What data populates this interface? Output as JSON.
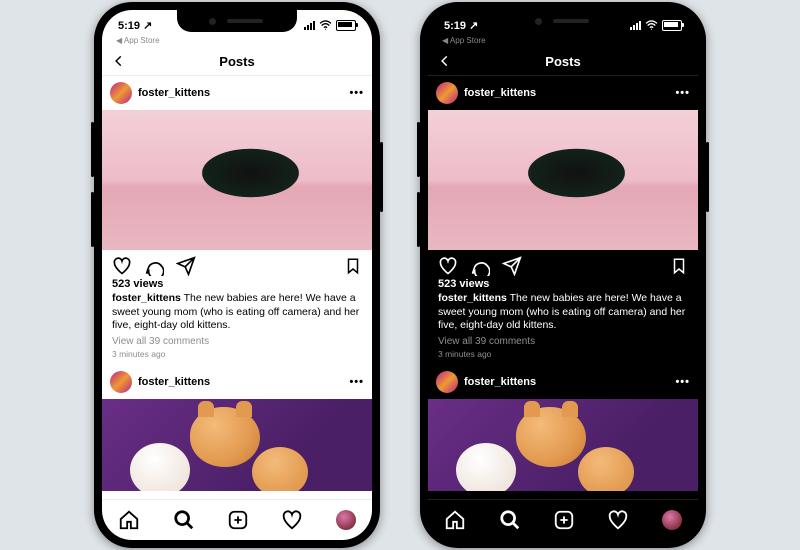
{
  "status": {
    "time": "5:19",
    "breadcrumb": "◀ App Store"
  },
  "header": {
    "title": "Posts"
  },
  "post": {
    "username": "foster_kittens",
    "views": "523 views",
    "caption_user": "foster_kittens",
    "caption_text": " The new babies are here! We have a sweet young mom (who is eating off camera) and her five, eight-day old kittens.",
    "view_comments": "View all 39 comments",
    "timestamp": "3 minutes ago"
  },
  "post2": {
    "username": "foster_kittens"
  },
  "icons": {
    "back": "chevron-left",
    "more": "•••",
    "like": "heart",
    "comment": "speech",
    "share": "paper-plane",
    "save": "bookmark",
    "home": "home",
    "search": "magnify",
    "add": "plus-box",
    "activity": "heart",
    "wifi": "wifi"
  }
}
